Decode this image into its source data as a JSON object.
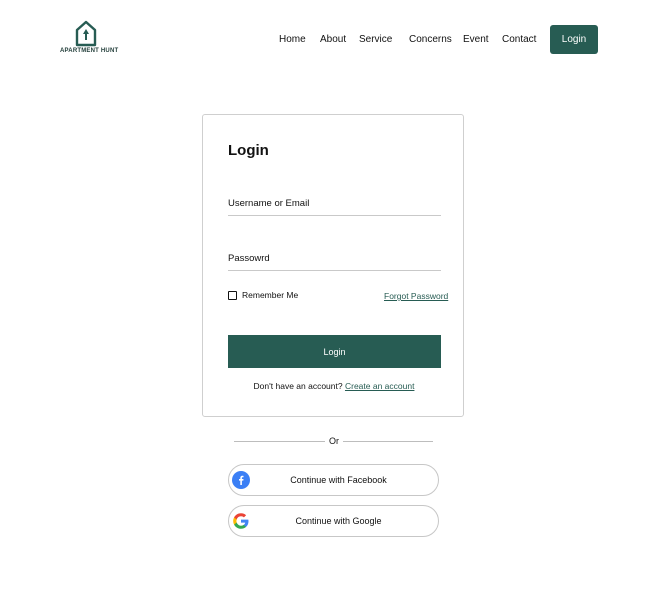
{
  "brand": {
    "name": "APARTMENT HUNT",
    "color": "#275c53"
  },
  "nav": {
    "items": [
      "Home",
      "About",
      "Service",
      "Concerns",
      "Event",
      "Contact"
    ],
    "login_label": "Login"
  },
  "login_card": {
    "title": "Login",
    "username_placeholder": "Username or Email",
    "password_placeholder": "Passowrd",
    "remember_label": "Remember Me",
    "remember_checked": false,
    "forgot_label": "Forgot Password",
    "submit_label": "Login",
    "signup_prompt": "Don't have an account?",
    "signup_link": "Create an account"
  },
  "divider_label": "Or",
  "social": {
    "facebook_label": "Continue with Facebook",
    "google_label": "Continue with Google"
  },
  "icons": [
    "house-logo-icon",
    "facebook-icon",
    "google-icon",
    "checkbox-icon"
  ]
}
